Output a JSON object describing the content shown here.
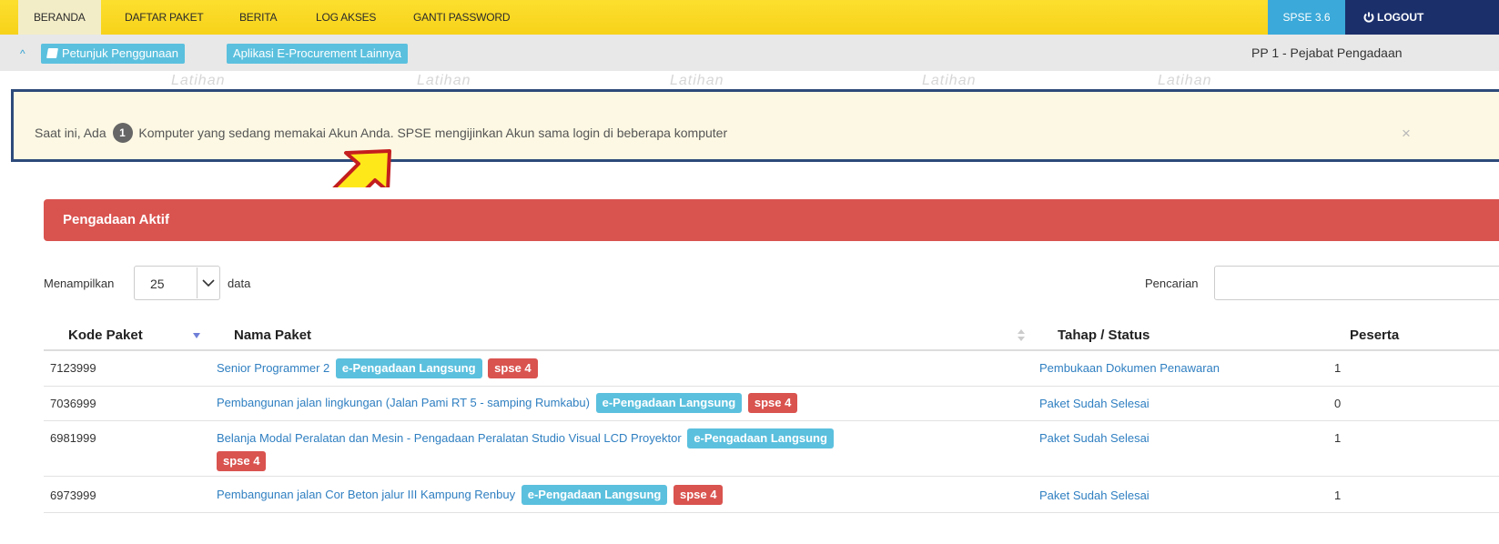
{
  "nav": {
    "items": [
      "BERANDA",
      "DAFTAR PAKET",
      "BERITA",
      "LOG AKSES",
      "GANTI PASSWORD"
    ],
    "version": "SPSE 3.6",
    "logout": "LOGOUT"
  },
  "subbar": {
    "guide": "Petunjuk Penggunaan",
    "other_apps": "Aplikasi E-Procurement Lainnya",
    "user": "PP 1 - Pejabat Pengadaan",
    "watermark": "Latihan"
  },
  "alert": {
    "prefix": "Saat ini, Ada",
    "count": "1",
    "suffix": "Komputer yang sedang memakai Akun Anda. SPSE mengijinkan Akun sama login di beberapa komputer",
    "close": "×"
  },
  "panel": {
    "title": "Pengadaan Aktif",
    "show_label": "Menampilkan",
    "page_size": "25",
    "data_label": "data",
    "search_label": "Pencarian",
    "search_value": ""
  },
  "table": {
    "headers": [
      "Kode Paket",
      "Nama Paket",
      "Tahap / Status",
      "Peserta"
    ],
    "rows": [
      {
        "kode": "7123999",
        "nama": "Senior Programmer 2",
        "nama2": "",
        "tag1": "e-Pengadaan Langsung",
        "tag2": "spse 4",
        "tahap": "Pembukaan Dokumen Penawaran",
        "peserta": "1"
      },
      {
        "kode": "7036999",
        "nama": "Pembangunan jalan lingkungan (Jalan Pami RT 5 - samping Rumkabu)",
        "nama2": "",
        "tag1": "e-Pengadaan Langsung",
        "tag2": "spse 4",
        "tahap": "Paket Sudah Selesai",
        "peserta": "0"
      },
      {
        "kode": "6981999",
        "nama": "Belanja Modal Peralatan dan Mesin - Pengadaan Peralatan Studio Visual LCD Proyektor",
        "nama2": "",
        "tag1": "e-Pengadaan Langsung",
        "tag2": "spse 4",
        "tahap": "Paket Sudah Selesai",
        "peserta": "1"
      },
      {
        "kode": "6973999",
        "nama": "Pembangunan jalan Cor Beton jalur III Kampung Renbuy",
        "nama2": "",
        "tag1": "e-Pengadaan Langsung",
        "tag2": "spse 4",
        "tahap": "Paket Sudah Selesai",
        "peserta": "1"
      }
    ]
  },
  "colors": {
    "nav_bg": "#f7d21a",
    "panel_head": "#d9534f",
    "label_blue": "#5bc0de",
    "alert_bg": "#fcf8e3",
    "arrow": "#ffe81a"
  }
}
